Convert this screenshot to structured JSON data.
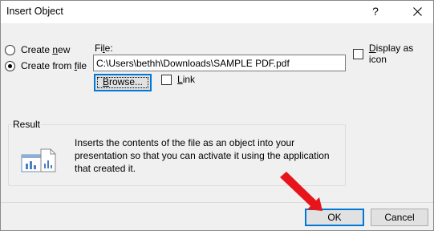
{
  "window": {
    "title": "Insert Object",
    "help_label": "?"
  },
  "options": {
    "create_new": {
      "pre": "Create ",
      "accel": "n",
      "post": "ew",
      "selected": false
    },
    "create_from_file": {
      "pre": "Create from ",
      "accel": "f",
      "post": "ile",
      "selected": true
    }
  },
  "file": {
    "label_pre": "Fi",
    "label_accel": "l",
    "label_post": "e:",
    "path_value": "C:\\Users\\bethh\\Downloads\\SAMPLE PDF.pdf",
    "browse_pre": "",
    "browse_accel": "B",
    "browse_post": "rowse...",
    "link_pre": "",
    "link_accel": "L",
    "link_post": "ink",
    "link_checked": false
  },
  "display_as_icon": {
    "pre": "",
    "accel": "D",
    "post": "isplay as icon",
    "checked": false
  },
  "result": {
    "title": "Result",
    "description": "Inserts the contents of the file as an object into your presentation so that you can activate it using the application that created it."
  },
  "buttons": {
    "ok_label": "OK",
    "cancel_label": "Cancel"
  },
  "colors": {
    "focus_accent": "#0078d7",
    "annotation_arrow": "#e8141b"
  }
}
